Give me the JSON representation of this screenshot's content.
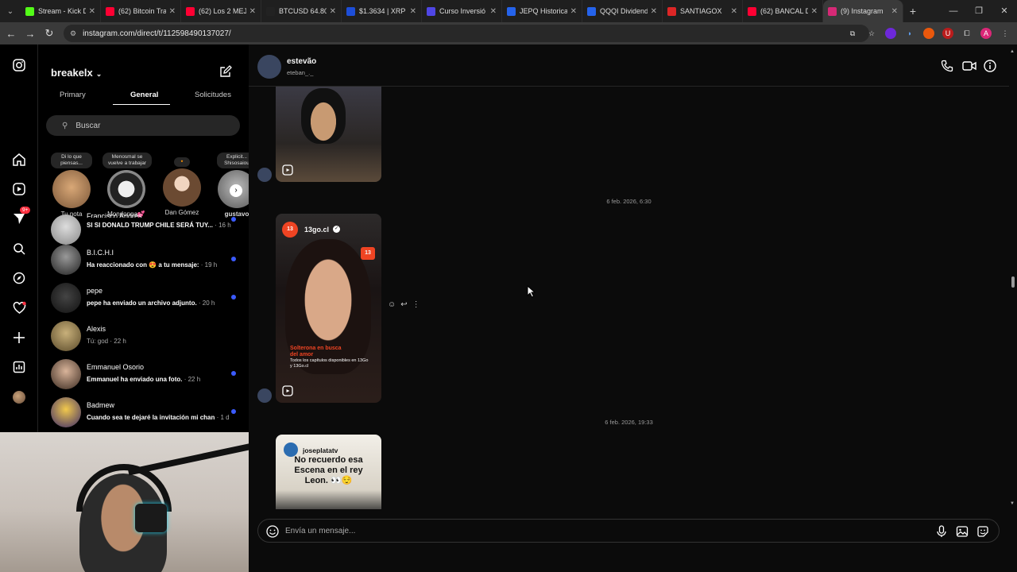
{
  "browser": {
    "tabs": [
      {
        "title": "Stream - Kick D",
        "icon": "kick-icon",
        "color": "#53fc18"
      },
      {
        "title": "(62) Bitcoin Tra",
        "icon": "youtube-icon",
        "color": "#ff0033"
      },
      {
        "title": "(62) Los 2 MEJ",
        "icon": "youtube-icon",
        "color": "#ff0033"
      },
      {
        "title": "BTCUSD 64.80",
        "icon": "tradingview-icon",
        "color": "#222"
      },
      {
        "title": "$1.3634 | XRP",
        "icon": "x-icon",
        "color": "#1d4ed8"
      },
      {
        "title": "Curso Inversió",
        "icon": "course-icon",
        "color": "#4f46e5"
      },
      {
        "title": "JEPQ Historical",
        "icon": "sa-icon",
        "color": "#2563eb"
      },
      {
        "title": "QQQI Dividend",
        "icon": "sa-icon",
        "color": "#2563eb"
      },
      {
        "title": "SANTIAGOX",
        "icon": "santiagox-icon",
        "color": "#dc2626"
      },
      {
        "title": "(62) BANCAL D",
        "icon": "youtube-icon",
        "color": "#ff0033"
      },
      {
        "title": "(9) Instagram",
        "icon": "instagram-icon",
        "color": "#d62976",
        "active": true
      }
    ],
    "url": "instagram.com/direct/t/112598490137027/"
  },
  "dm": {
    "account": "breakelx",
    "tabs": [
      "Primary",
      "General",
      "Solicitudes"
    ],
    "search_placeholder": "Buscar",
    "notifications_badge": "9+",
    "notes": [
      {
        "bubble": "Di lo que piensas...",
        "name": "Tu nota"
      },
      {
        "bubble": "Menosmal se vuelve a trabajar",
        "name": "Mondonga💕"
      },
      {
        "bubble": "🔸",
        "name": "Dan Gómez"
      },
      {
        "bubble": "Explicit... Shisosaiou",
        "name": "gustavo"
      }
    ],
    "partial_conversation_name": "Francisco Andrés",
    "conversations": [
      {
        "name": "",
        "preview": "SI SI DONALD TRUMP CHILE SERÁ TUY...",
        "time": "· 16 h",
        "unread": true
      },
      {
        "name": "B.I.C.H.I",
        "preview": "Ha reaccionado con 😍 a tu mensaje:",
        "time": "· 19 h",
        "unread": true
      },
      {
        "name": "pepe",
        "preview": "pepe ha enviado un archivo adjunto.",
        "time": "· 20 h",
        "unread": true
      },
      {
        "name": "Alexis",
        "preview": "Tú: god",
        "time": "· 22 h",
        "unread": false
      },
      {
        "name": "Emmanuel Osorio",
        "preview": "Emmanuel ha enviado una foto.",
        "time": "· 22 h",
        "unread": true
      },
      {
        "name": "Badmew",
        "preview": "Cuando sea te dejaré la invitación mi chan",
        "time": "· 1 d",
        "unread": true
      }
    ]
  },
  "chat": {
    "name": "estevão",
    "username": "eteban_._",
    "timestamps": [
      "6 feb. 2026, 6:30",
      "6 feb. 2026, 19:33"
    ],
    "reel2": {
      "account": "13go.cl",
      "badge": "13",
      "caption": "Solterona en busca del amor",
      "sub": "Todos los capítulos disponibles en 13Go y 13Go.cl"
    },
    "reel3": {
      "account": "joseplatatv",
      "text": "No recuerdo esa Escena en el rey Leon. 👀😌"
    },
    "composer_placeholder": "Envía un mensaje..."
  }
}
